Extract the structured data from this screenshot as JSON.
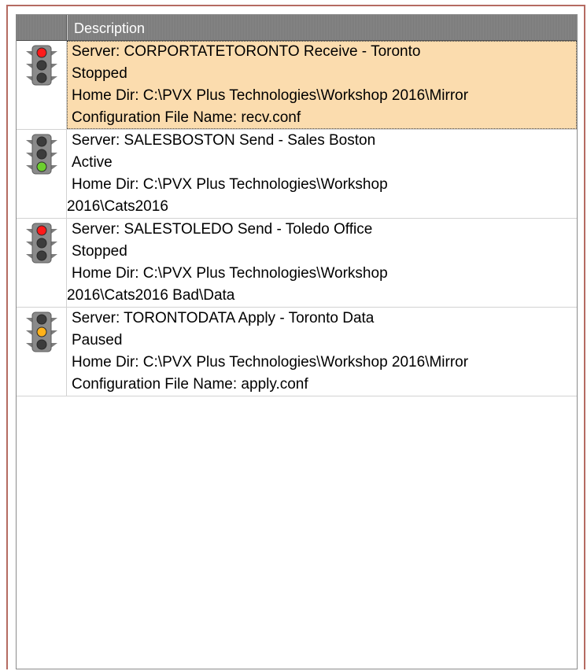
{
  "list": {
    "header": {
      "description": "Description"
    },
    "items": [
      {
        "light": "red",
        "selected": true,
        "lines": [
          "Server: CORPORTATETORONTO  Receive -  Toronto",
          "Stopped",
          "Home Dir: C:\\PVX Plus Technologies\\Workshop 2016\\Mirror",
          "Configuration File Name: recv.conf"
        ]
      },
      {
        "light": "green",
        "selected": false,
        "lines": [
          "Server: SALESBOSTON  Send -  Sales Boston",
          "Active",
          "Home Dir: C:\\PVX Plus Technologies\\Workshop",
          "2016\\Cats2016"
        ]
      },
      {
        "light": "red",
        "selected": false,
        "lines": [
          "Server: SALESTOLEDO  Send -  Toledo Office",
          "Stopped",
          "Home Dir: C:\\PVX Plus Technologies\\Workshop",
          "2016\\Cats2016 Bad\\Data"
        ]
      },
      {
        "light": "amber",
        "selected": false,
        "lines": [
          "Server: TORONTODATA  Apply -  Toronto Data",
          "Paused",
          "Home Dir: C:\\PVX Plus Technologies\\Workshop 2016\\Mirror",
          "Configuration File Name: apply.conf"
        ]
      }
    ]
  },
  "colors": {
    "red": "#ff1a1a",
    "green": "#6ccf2e",
    "amber": "#ffb21a",
    "unlit": "#3c3c3c",
    "selection": "#fbdcae",
    "frame": "#b56b62"
  },
  "icons": {
    "status": "traffic-light-icon"
  }
}
